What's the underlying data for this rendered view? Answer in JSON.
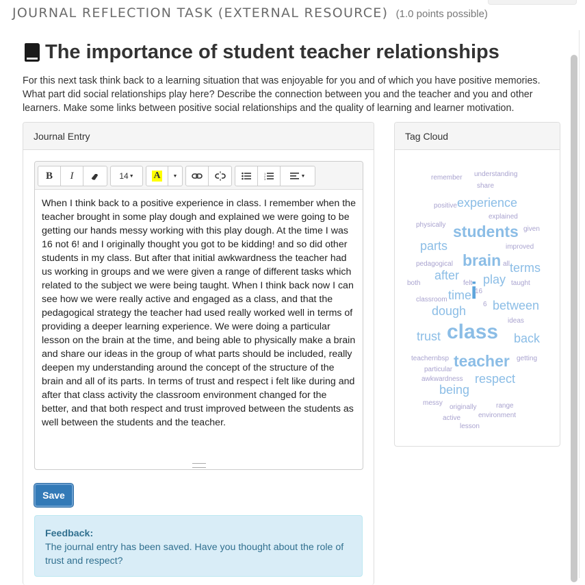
{
  "task": {
    "title": "JOURNAL REFLECTION TASK (EXTERNAL RESOURCE)",
    "points": "(1.0 points possible)"
  },
  "heading": "The importance of student teacher relationships",
  "intro": "For this next task think back to a learning situation that was enjoyable for you and of which you have positive memories. What part did social relationships play here? Describe the connection between you and the teacher and you and other learners. Make some links between positive social relationships and the quality of learning and learner motivation.",
  "journal": {
    "panel_title": "Journal Entry",
    "toolbar": {
      "bold": "B",
      "italic": "I",
      "font_size": "14",
      "text_color": "A"
    },
    "entry_text": "When I think back to a positive experience in class. I remember when the teacher brought in some play dough and explained we were going to be getting our hands messy working with this play dough. At the time I was 16 not 6! and I originally thought you got to be kidding! and so did other students in my class. But after that initial awkwardness the teacher had us working in groups and we were given a range of different tasks which related to the subject we were being taught. When I think back now I can see how we were really active and engaged as a class, and that the pedagogical strategy the teacher had used really worked well in terms of providing a deeper learning experience. We were doing a particular lesson on the brain at the time, and being able to physically make a brain and share our ideas in the group of what parts should be included, really deepen my understanding around the concept of the structure of the brain and all of its parts. In terms of trust and respect i felt like during and after that class activity the classroom environment changed for the better, and that both respect and trust improved between the students as well between the students and the teacher.",
    "save_label": "Save",
    "feedback_title": "Feedback:",
    "feedback_text": "The journal entry has been saved. Have you thought about the role of trust and respect?"
  },
  "tag_cloud": {
    "panel_title": "Tag Cloud",
    "colors": {
      "light": "#b9d6ee",
      "mid": "#8bbde6",
      "dark": "#5fa5dc"
    },
    "tags": [
      {
        "word": "remember",
        "size": 10
      },
      {
        "word": "understanding",
        "size": 10
      },
      {
        "word": "share",
        "size": 10
      },
      {
        "word": "positive",
        "size": 10
      },
      {
        "word": "experience",
        "size": 18
      },
      {
        "word": "explained",
        "size": 10
      },
      {
        "word": "physically",
        "size": 10
      },
      {
        "word": "students",
        "size": 23
      },
      {
        "word": "given",
        "size": 10
      },
      {
        "word": "parts",
        "size": 18
      },
      {
        "word": "improved",
        "size": 10
      },
      {
        "word": "pedagogical",
        "size": 10
      },
      {
        "word": "brain",
        "size": 23
      },
      {
        "word": "all",
        "size": 10
      },
      {
        "word": "terms",
        "size": 18
      },
      {
        "word": "both",
        "size": 10
      },
      {
        "word": "after",
        "size": 18
      },
      {
        "word": "felt",
        "size": 10
      },
      {
        "word": "play",
        "size": 18
      },
      {
        "word": "taught",
        "size": 10
      },
      {
        "word": "classroom",
        "size": 10
      },
      {
        "word": "time",
        "size": 18
      },
      {
        "word": "i",
        "size": 34
      },
      {
        "word": "6",
        "size": 10
      },
      {
        "word": "16",
        "size": 10
      },
      {
        "word": "between",
        "size": 18
      },
      {
        "word": "dough",
        "size": 18
      },
      {
        "word": "ideas",
        "size": 10
      },
      {
        "word": "trust",
        "size": 18
      },
      {
        "word": "class",
        "size": 30
      },
      {
        "word": "back",
        "size": 18
      },
      {
        "word": "teachernbsp",
        "size": 10
      },
      {
        "word": "teacher",
        "size": 23
      },
      {
        "word": "getting",
        "size": 10
      },
      {
        "word": "particular",
        "size": 10
      },
      {
        "word": "awkwardness",
        "size": 10
      },
      {
        "word": "respect",
        "size": 18
      },
      {
        "word": "being",
        "size": 18
      },
      {
        "word": "messy",
        "size": 10
      },
      {
        "word": "originally",
        "size": 10
      },
      {
        "word": "range",
        "size": 10
      },
      {
        "word": "environment",
        "size": 10
      },
      {
        "word": "active",
        "size": 10
      },
      {
        "word": "lesson",
        "size": 10
      }
    ]
  }
}
